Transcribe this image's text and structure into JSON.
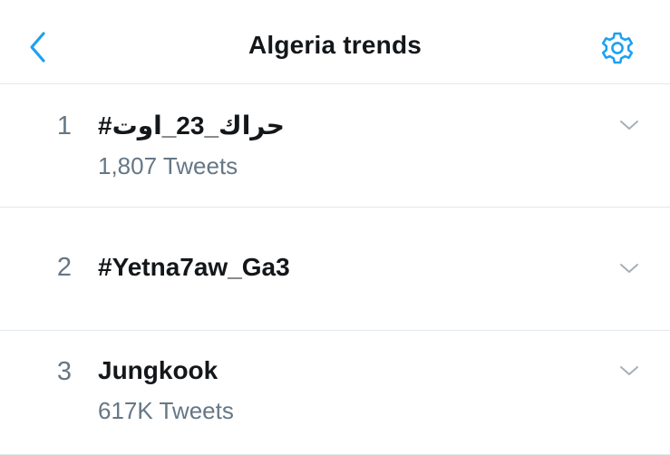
{
  "header": {
    "title": "Algeria trends",
    "back_icon": "chevron-left-icon",
    "settings_icon": "gear-icon"
  },
  "trends": [
    {
      "rank": "1",
      "name": "#حراك_23_اوت",
      "tweets": "1,807 Tweets"
    },
    {
      "rank": "2",
      "name": "#Yetna7aw_Ga3",
      "tweets": ""
    },
    {
      "rank": "3",
      "name": "Jungkook",
      "tweets": "617K Tweets"
    }
  ],
  "colors": {
    "accent": "#1da1f2",
    "primary_text": "#14171a",
    "secondary_text": "#657786",
    "divider": "#e1e8ed"
  }
}
